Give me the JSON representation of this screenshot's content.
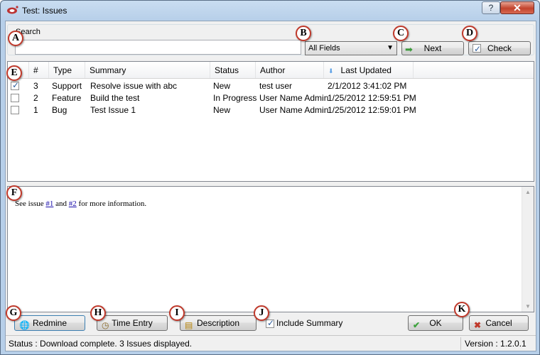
{
  "window": {
    "title": "Test: Issues",
    "help_label": "?",
    "close_label": "✕"
  },
  "search": {
    "label": "Search",
    "value": "",
    "placeholder": "",
    "field_selected": "All Fields",
    "next_label": "Next",
    "check_label": "Check"
  },
  "table": {
    "columns": [
      "#",
      "Type",
      "Summary",
      "Status",
      "Author",
      "Last Updated"
    ],
    "sorted_column": "Last Updated",
    "rows": [
      {
        "checked": true,
        "id": "3",
        "type": "Support",
        "summary": "Resolve issue with abc",
        "status": "New",
        "author": "test user",
        "updated": "2/1/2012 3:41:02 PM"
      },
      {
        "checked": false,
        "id": "2",
        "type": "Feature",
        "summary": "Build the test",
        "status": "In Progress",
        "author": "User Name Admin",
        "updated": "1/25/2012 12:59:51 PM"
      },
      {
        "checked": false,
        "id": "1",
        "type": "Bug",
        "summary": "Test Issue 1",
        "status": "New",
        "author": "User Name Admin",
        "updated": "1/25/2012 12:59:01 PM"
      }
    ]
  },
  "description": {
    "prefix": "See issue",
    "link1": "#1",
    "middle": "and",
    "link2": "#2",
    "suffix": "for more information."
  },
  "buttons": {
    "redmine": "Redmine",
    "time_entry": "Time Entry",
    "description": "Description",
    "include_summary": "Include Summary",
    "include_summary_checked": true,
    "ok": "OK",
    "cancel": "Cancel"
  },
  "status": {
    "text": "Status : Download complete. 3 Issues displayed.",
    "version": "Version : 1.2.0.1"
  },
  "callouts": [
    "A",
    "B",
    "C",
    "D",
    "E",
    "F",
    "G",
    "H",
    "I",
    "J",
    "K"
  ],
  "colors": {
    "callout_border": "#c0392b",
    "link": "#1a0dab",
    "close_button": "#c3432c"
  }
}
